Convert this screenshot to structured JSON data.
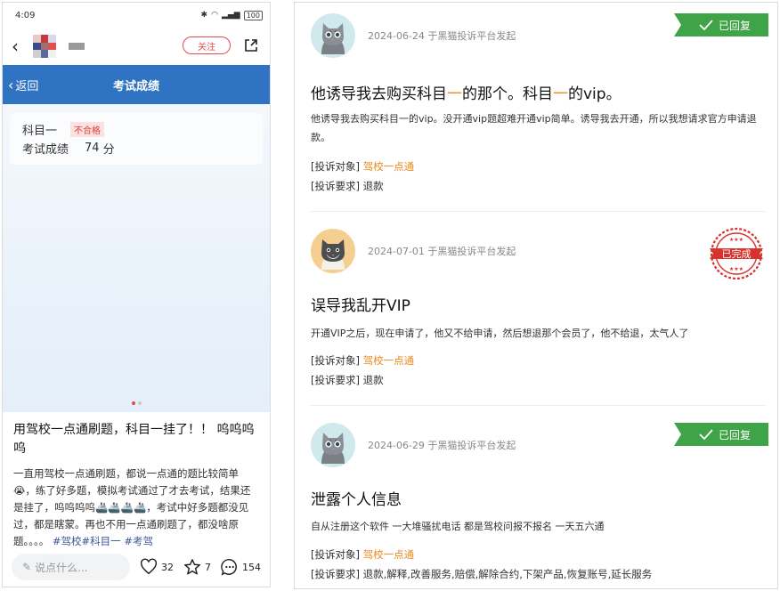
{
  "phone": {
    "status": {
      "time": "4:09",
      "battery": "100"
    },
    "follow_label": "关注",
    "nav": {
      "back_label": "返回",
      "title": "考试成绩"
    },
    "score": {
      "subject_label": "科目一",
      "subject_status": "不合格",
      "score_label": "考试成绩",
      "score_value": "74",
      "score_unit": "分"
    },
    "post": {
      "title": "用驾校一点通刷题，科目一挂了！！ 呜呜呜呜",
      "body": "一直用驾校一点通刷题，都说一点通的题比较简单😭，练了好多题，模拟考试通过了才去考试，结果还是挂了，呜呜呜呜🚢🚢🚢🚢，考试中好多题都没见过，都是瞎蒙。再也不用一点通刷题了，都没啥原题。。。。",
      "tags": "#驾校#科目一 #考驾"
    },
    "bottom": {
      "comment_placeholder": "说点什么...",
      "likes": "32",
      "stars": "7",
      "comments": "154"
    }
  },
  "complaints": [
    {
      "meta": "2024-06-24 于黑猫投诉平台发起",
      "status": "已回复",
      "title_parts": [
        "他诱导我去购买科目",
        "一",
        "的那个。科目",
        "一",
        "的vip。"
      ],
      "desc": "他诱导我去购买科目一的vip。没开通vip题超难开通vip简单。诱导我去开通，所以我想请求官方申请退款。",
      "target_label": "[投诉对象]",
      "target": "驾校一点通",
      "request_label": "[投诉要求]",
      "request": "退款"
    },
    {
      "meta": "2024-07-01 于黑猫投诉平台发起",
      "status": "已完成",
      "title": "误导我乱开VIP",
      "desc": "开通VIP之后，现在申请了，他又不给申请，然后想退那个会员了，他不给退，太气人了",
      "target_label": "[投诉对象]",
      "target": "驾校一点通",
      "request_label": "[投诉要求]",
      "request": "退款"
    },
    {
      "meta": "2024-06-29 于黑猫投诉平台发起",
      "status": "已回复",
      "title": "泄露个人信息",
      "desc": "自从注册这个软件 一大堆骚扰电话 都是驾校问报不报名 一天五六通",
      "target_label": "[投诉对象]",
      "target": "驾校一点通",
      "request_label": "[投诉要求]",
      "request": "退款,解释,改善服务,赔偿,解除合约,下架产品,恢复账号,延长服务"
    }
  ]
}
